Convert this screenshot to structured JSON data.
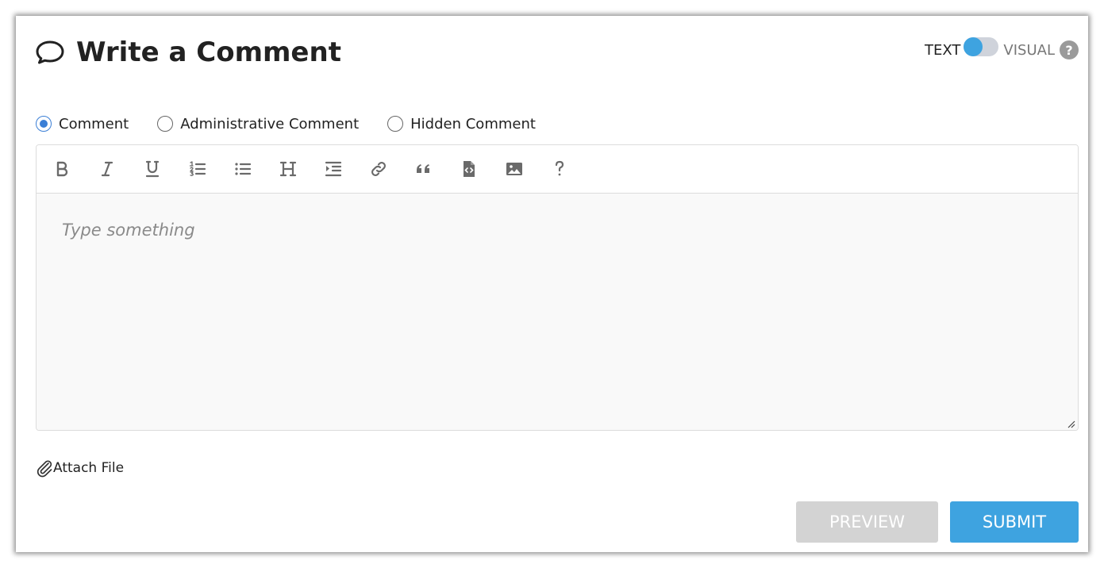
{
  "header": {
    "title": "Write a Comment",
    "title_icon": "speech-bubble-icon"
  },
  "mode_toggle": {
    "left_label": "TEXT",
    "right_label": "VISUAL",
    "selected": "TEXT",
    "help_glyph": "?",
    "accent_color": "#3ea3e0"
  },
  "comment_types": {
    "options": [
      {
        "label": "Comment",
        "checked": true
      },
      {
        "label": "Administrative Comment",
        "checked": false
      },
      {
        "label": "Hidden Comment",
        "checked": false
      }
    ]
  },
  "toolbar": {
    "buttons": [
      {
        "name": "bold",
        "icon": "bold-icon"
      },
      {
        "name": "italic",
        "icon": "italic-icon"
      },
      {
        "name": "underline",
        "icon": "underline-icon"
      },
      {
        "name": "ordered-list",
        "icon": "ordered-list-icon"
      },
      {
        "name": "unordered-list",
        "icon": "unordered-list-icon"
      },
      {
        "name": "heading",
        "icon": "heading-icon"
      },
      {
        "name": "indent",
        "icon": "indent-icon"
      },
      {
        "name": "link",
        "icon": "link-icon"
      },
      {
        "name": "quote",
        "icon": "quote-icon"
      },
      {
        "name": "code-file",
        "icon": "code-file-icon"
      },
      {
        "name": "image",
        "icon": "image-icon"
      },
      {
        "name": "help",
        "icon": "question-mark-icon"
      }
    ]
  },
  "editor": {
    "placeholder": "Type something",
    "value": ""
  },
  "attach": {
    "label": "Attach File",
    "icon": "paperclip-icon"
  },
  "actions": {
    "preview_label": "PREVIEW",
    "submit_label": "SUBMIT",
    "preview_color": "#d3d3d3",
    "submit_color": "#3ea3e0"
  }
}
